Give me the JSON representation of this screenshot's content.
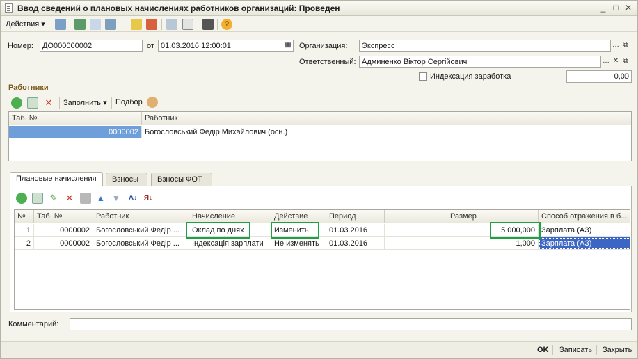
{
  "window": {
    "title": "Ввод сведений о плановых начислениях работников организаций: Проведен",
    "min": "_",
    "max": "□",
    "close": "✕"
  },
  "toolbar": {
    "actions_label": "Действия"
  },
  "header": {
    "number_label": "Номер:",
    "number_value": "ДО000000002",
    "date_label": "от",
    "date_value": "01.03.2016 12:00:01",
    "org_label": "Организация:",
    "org_value": "Экспресс",
    "responsible_label": "Ответственный:",
    "responsible_value": "Админенко Віктор Сергійович",
    "indexation_label": "Индексация заработка",
    "indexation_value": "0,00"
  },
  "workers": {
    "title": "Работники",
    "fill_label": "Заполнить",
    "pick_label": "Подбор",
    "columns": [
      "Таб. №",
      "Работник"
    ],
    "rows": [
      {
        "tab": "0000002",
        "name": "Богословський Федір Михайлович (осн.)"
      }
    ]
  },
  "tabs": [
    "Плановые начисления",
    "Взносы",
    "Взносы ФОТ"
  ],
  "accruals": {
    "columns": [
      "№",
      "Таб. №",
      "Работник",
      "Начисление",
      "Действие",
      "Период",
      "",
      "Размер",
      "Способ отражения в б..."
    ],
    "rows": [
      {
        "n": "1",
        "tab": "0000002",
        "worker": "Богословський Федір ...",
        "accrual": "Оклад по днях",
        "action": "Изменить",
        "period": "01.03.2016",
        "extra": "",
        "size": "5 000,000",
        "method": "Зарплата (АЗ)"
      },
      {
        "n": "2",
        "tab": "0000002",
        "worker": "Богословський Федір ...",
        "accrual": "Індексація зарплати",
        "action": "Не изменять",
        "period": "01.03.2016",
        "extra": "",
        "size": "1,000",
        "method": "Зарплата (АЗ)"
      }
    ]
  },
  "footer": {
    "comment_label": "Комментарий:",
    "comment_value": "",
    "ok": "OK",
    "save": "Записать",
    "close": "Закрыть"
  },
  "colors": {
    "highlight": "#1ea044",
    "selection": "#3b66c4",
    "selected_row": "#6e9fdb"
  }
}
